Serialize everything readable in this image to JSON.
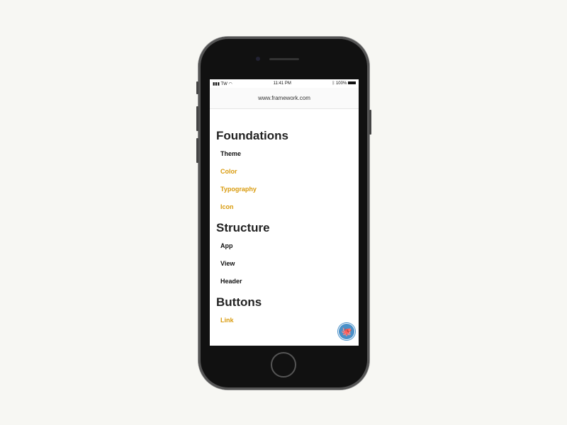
{
  "status": {
    "carrier": "TW",
    "time": "11:41 PM",
    "battery": "100%"
  },
  "browser": {
    "url": "www.framework.com"
  },
  "sections": [
    {
      "title": "Foundations",
      "items": [
        {
          "label": "Theme",
          "active": false
        },
        {
          "label": "Color",
          "active": true
        },
        {
          "label": "Typography",
          "active": true
        },
        {
          "label": "Icon",
          "active": true
        }
      ]
    },
    {
      "title": "Structure",
      "items": [
        {
          "label": "App",
          "active": false
        },
        {
          "label": "View",
          "active": false
        },
        {
          "label": "Header",
          "active": false
        }
      ]
    },
    {
      "title": "Buttons",
      "items": [
        {
          "label": "Link",
          "active": true
        }
      ]
    }
  ],
  "accent": "#d99a0b",
  "fab_icon": "github-icon"
}
